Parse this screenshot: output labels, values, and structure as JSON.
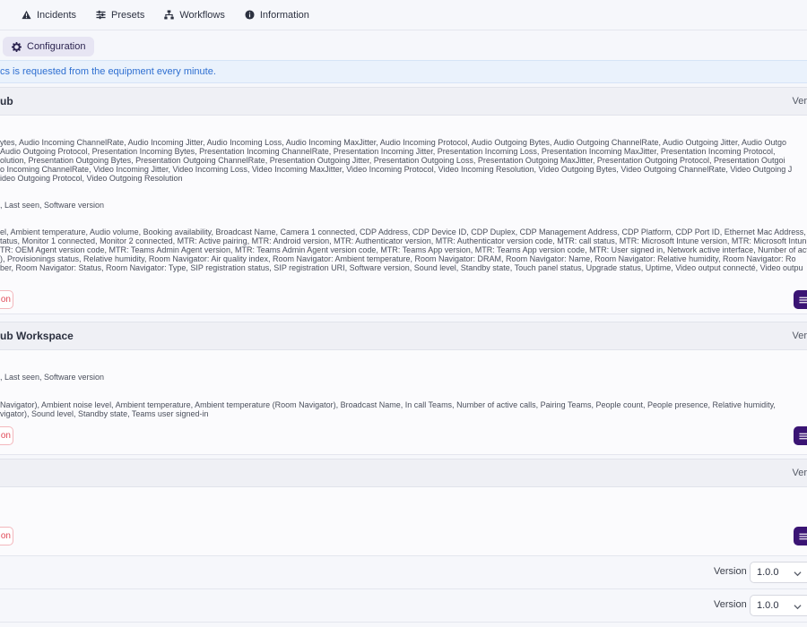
{
  "nav": {
    "items": [
      {
        "label": "Incidents",
        "icon": "alert-triangle-icon"
      },
      {
        "label": "Presets",
        "icon": "sliders-icon"
      },
      {
        "label": "Workflows",
        "icon": "workflow-icon"
      },
      {
        "label": "Information",
        "icon": "info-circle-icon"
      }
    ]
  },
  "subnav": {
    "configuration_label": "Configuration"
  },
  "info_banner": "cs is requested from the equipment every minute.",
  "sections": [
    {
      "title": "ub",
      "version_label": "Ver",
      "lines": [
        "ytes, Audio Incoming ChannelRate, Audio Incoming Jitter, Audio Incoming Loss, Audio Incoming MaxJitter, Audio Incoming Protocol, Audio Outgoing Bytes, Audio Outgoing ChannelRate, Audio Outgoing Jitter, Audio Outgo",
        "Audio Outgoing Protocol, Presentation Incoming Bytes, Presentation Incoming ChannelRate, Presentation Incoming Jitter, Presentation Incoming Loss, Presentation Incoming MaxJitter, Presentation Incoming Protocol,",
        "olution, Presentation Outgoing Bytes, Presentation Outgoing ChannelRate, Presentation Outgoing Jitter, Presentation Outgoing Loss, Presentation Outgoing MaxJitter, Presentation Outgoing Protocol, Presentation Outgoi",
        "o Incoming ChannelRate, Video Incoming Jitter, Video Incoming Loss, Video Incoming MaxJitter, Video Incoming Protocol, Video Incoming Resolution, Video Outgoing Bytes, Video Outgoing ChannelRate, Video Outgoing J",
        "ideo Outgoing Protocol, Video Outgoing Resolution",
        ", Last seen, Software version",
        "el, Ambient temperature, Audio volume, Booking availability, Broadcast Name, Camera 1 connected, CDP Address, CDP Device ID, CDP Duplex, CDP Management Address, CDP Platform, CDP Port ID, Ethernet Mac Address,",
        "tatus, Monitor 1 connected, Monitor 2 connected, MTR: Active pairing, MTR: Android version, MTR: Authenticator version, MTR: Authenticator version code, MTR: call status, MTR: Microsoft Intune version, MTR: Microsoft Intun",
        "TR: OEM Agent version code, MTR: Teams Admin Agent version, MTR: Teams Admin Agent version code, MTR: Teams App version, MTR: Teams App version code, MTR: User signed in, Network active interface, Number of activ",
        "), Provisionings status, Relative humidity, Room Navigator: Air quality index, Room Navigator: Ambient temperature, Room Navigator: DRAM, Room Navigator: Name, Room Navigator: Relative humidity, Room Navigator: Ro",
        "ber, Room Navigator: Status, Room Navigator: Type, SIP registration status, SIP registration URI, Software version, Sound level, Standby state, Touch panel status, Upgrade status, Uptime, Video output connecté, Video outpu"
      ],
      "remove_label": "on"
    },
    {
      "title": "ub Workspace",
      "version_label": "Ver",
      "lines": [
        ", Last seen, Software version",
        "Navigator), Ambient noise level, Ambient temperature, Ambient temperature (Room Navigator), Broadcast Name, In call Teams, Number of active calls, Pairing Teams, People count, People presence, Relative humidity,",
        "vigator), Sound level, Standby state, Teams user signed-in"
      ],
      "remove_label": "on"
    },
    {
      "title": "",
      "version_label": "Ver",
      "lines": [],
      "remove_label": "on"
    }
  ],
  "version_rows": [
    {
      "label": "Version",
      "value": "1.0.0"
    },
    {
      "label": "Version",
      "value": "1.0.0"
    }
  ]
}
